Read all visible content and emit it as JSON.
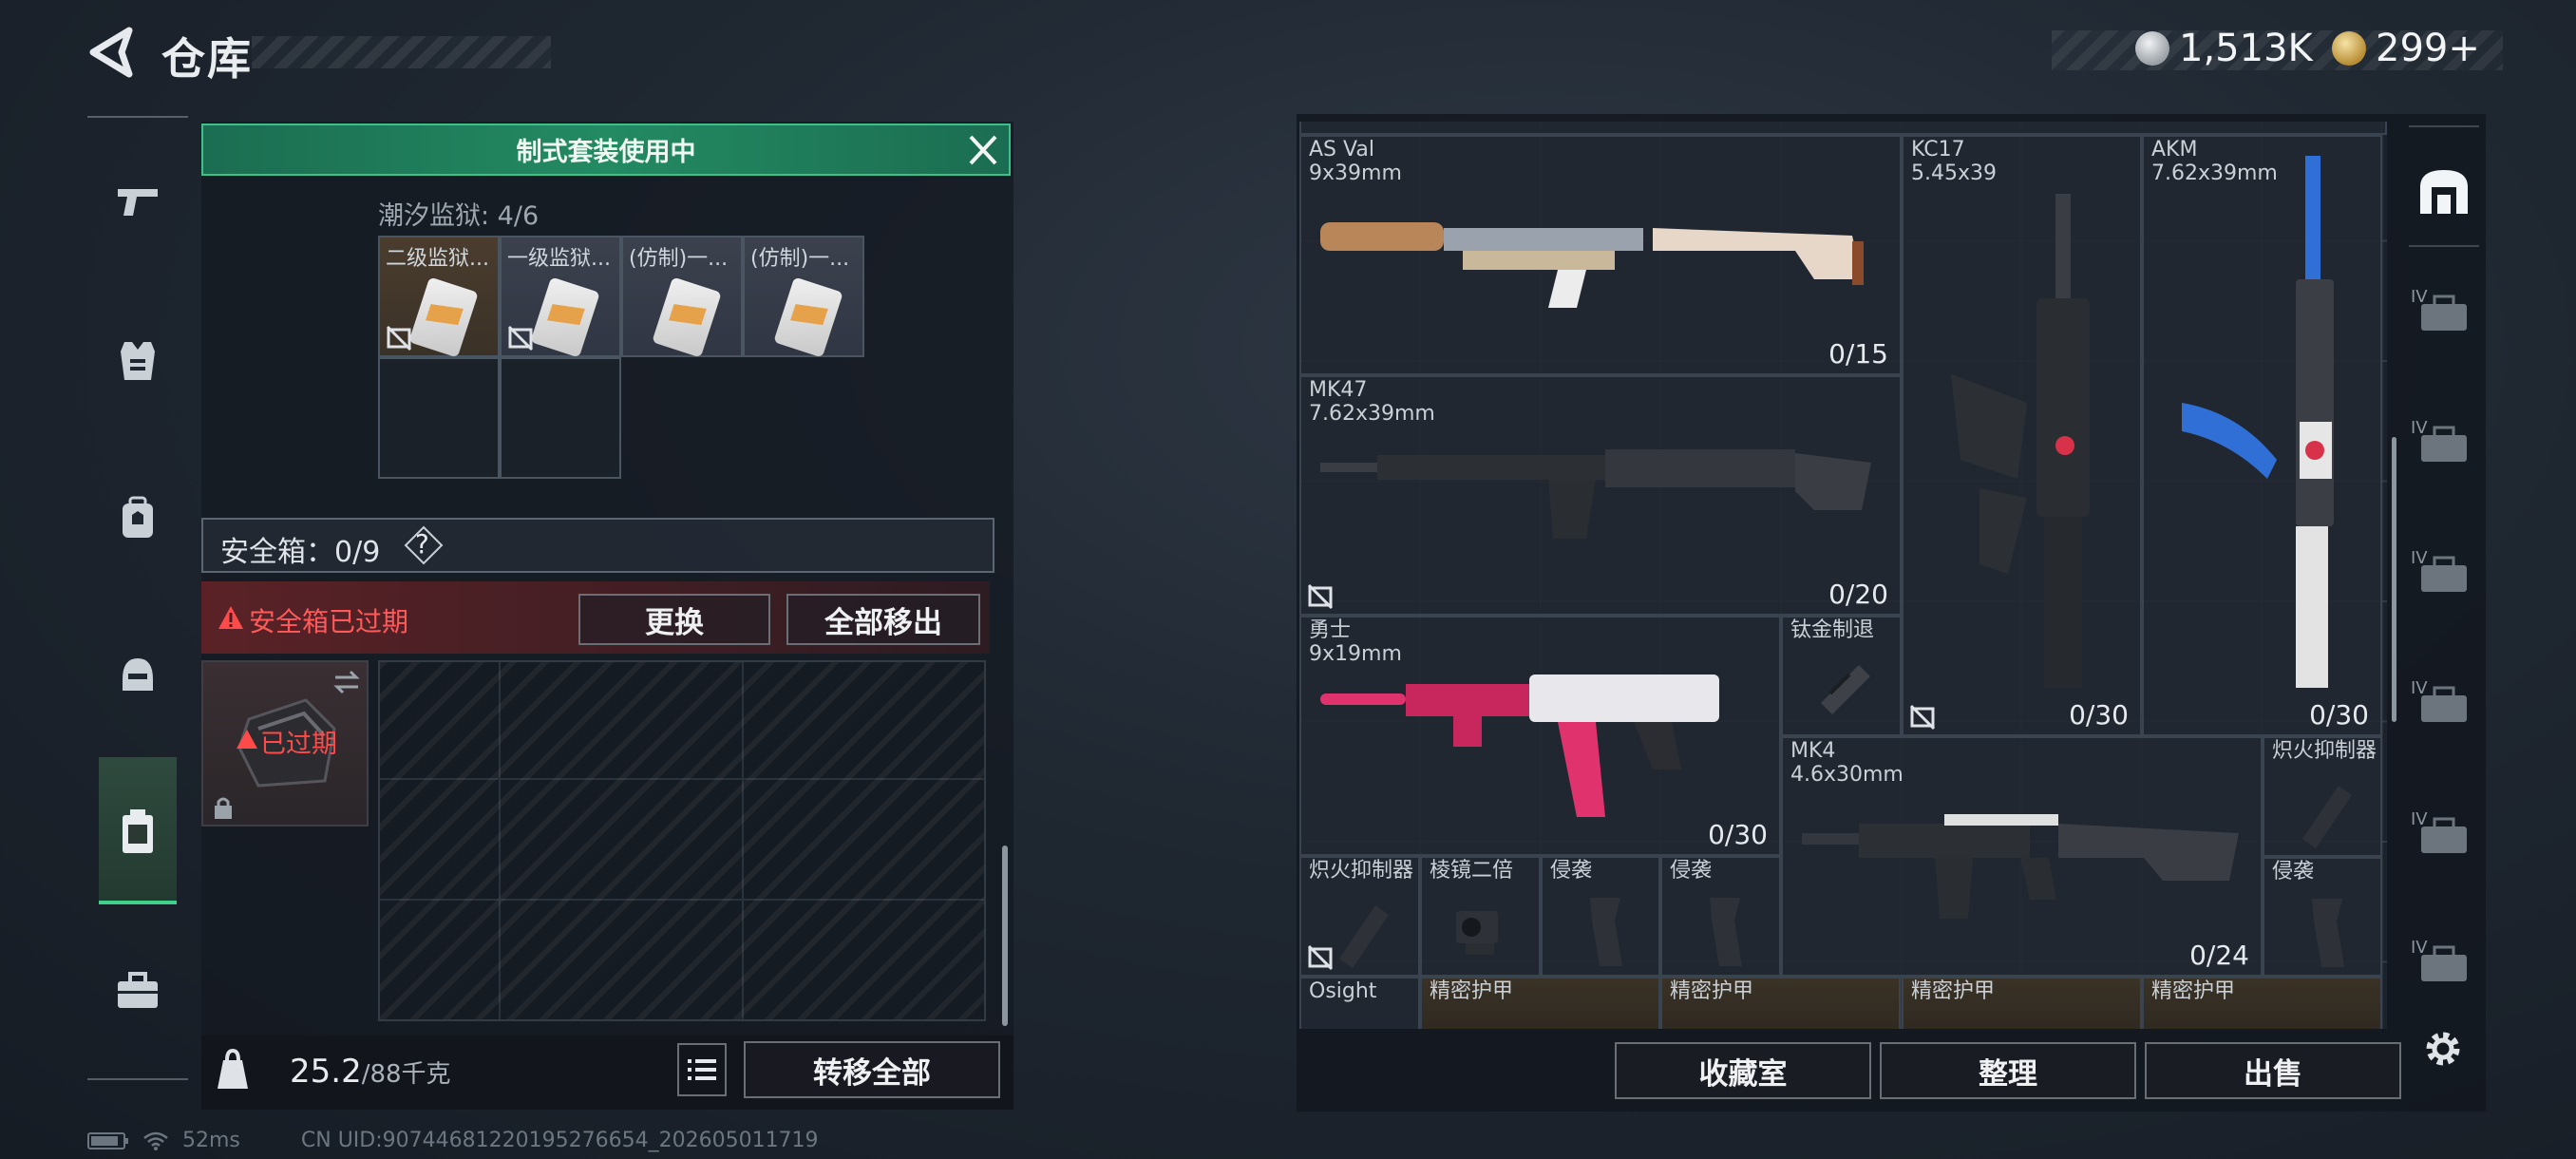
{
  "header": {
    "title": "仓库"
  },
  "currency": [
    {
      "icon": "silver-coin-icon",
      "value": "1,513K",
      "color": "#c9ccd0"
    },
    {
      "icon": "gold-coin-icon",
      "value": "299+",
      "color": "#d9b45a"
    }
  ],
  "nav": {
    "items": [
      {
        "icon": "pistol-icon"
      },
      {
        "icon": "vest-icon"
      },
      {
        "icon": "backpack-icon"
      },
      {
        "icon": "helmet-icon"
      },
      {
        "icon": "safe-box-icon",
        "active": true
      },
      {
        "icon": "toolbox-icon"
      }
    ]
  },
  "left_panel": {
    "kit_banner": "制式套装使用中",
    "section_label": "潮汐监狱: 4/6",
    "cards": [
      {
        "label": "二级监狱..."
      },
      {
        "label": "一级监狱..."
      },
      {
        "label": "(仿制)一..."
      },
      {
        "label": "(仿制)一..."
      }
    ],
    "safe_box_label": "安全箱：0/9",
    "help_symbol": "?",
    "expired_warning": "安全箱已过期",
    "replace_button": "更换",
    "move_all_out_button": "全部移出",
    "expired_badge": "已过期",
    "weight_current": "25.2",
    "weight_max": "/88千克",
    "transfer_all_button": "转移全部"
  },
  "status_bar": {
    "ping": "52ms",
    "uid": "CN UID:9074468122019527665​4_202605011719"
  },
  "inventory": {
    "items": [
      {
        "name": "AS Val",
        "caliber": "9x39mm",
        "count": "0/15"
      },
      {
        "name": "KC17",
        "caliber": "5.45x39",
        "count": "0/30"
      },
      {
        "name": "AKM",
        "caliber": "7.62x39mm",
        "count": "0/30"
      },
      {
        "name": "MK47",
        "caliber": "7.62x39mm",
        "count": "0/20"
      },
      {
        "name": "勇士",
        "caliber": "9x19mm",
        "count": "0/30"
      },
      {
        "name": "钛金制退",
        "caliber": "",
        "count": ""
      },
      {
        "name": "MK4",
        "caliber": "4.6x30mm",
        "count": "0/24"
      },
      {
        "name": "炽火抑制器",
        "caliber": "",
        "count": ""
      },
      {
        "name": "炽火抑制器",
        "caliber": "",
        "count": ""
      },
      {
        "name": "棱镜二倍",
        "caliber": "",
        "count": ""
      },
      {
        "name": "侵袭",
        "caliber": "",
        "count": ""
      },
      {
        "name": "侵袭",
        "caliber": "",
        "count": ""
      },
      {
        "name": "侵袭",
        "caliber": "",
        "count": ""
      },
      {
        "name": "Osight",
        "caliber": "",
        "count": ""
      },
      {
        "name": "精密护甲",
        "caliber": "",
        "count": ""
      },
      {
        "name": "精密护甲",
        "caliber": "",
        "count": ""
      },
      {
        "name": "精密护甲",
        "caliber": "",
        "count": ""
      },
      {
        "name": "精密护甲",
        "caliber": "",
        "count": ""
      }
    ]
  },
  "bottom_buttons": {
    "collection": "收藏室",
    "sort": "整理",
    "sell": "出售"
  },
  "right_tabs": {
    "items": [
      {
        "icon": "stash-icon",
        "label": ""
      },
      {
        "icon": "case-iv-icon",
        "label": "IV"
      },
      {
        "icon": "case-iv-icon",
        "label": "IV"
      },
      {
        "icon": "case-iv-icon",
        "label": "IV"
      },
      {
        "icon": "case-iv-icon",
        "label": "IV"
      },
      {
        "icon": "case-iv-icon",
        "label": "IV"
      },
      {
        "icon": "case-iv-icon",
        "label": "IV"
      }
    ]
  },
  "colors": {
    "accent_green": "#238a62",
    "warning_red": "#ff5a5a"
  }
}
